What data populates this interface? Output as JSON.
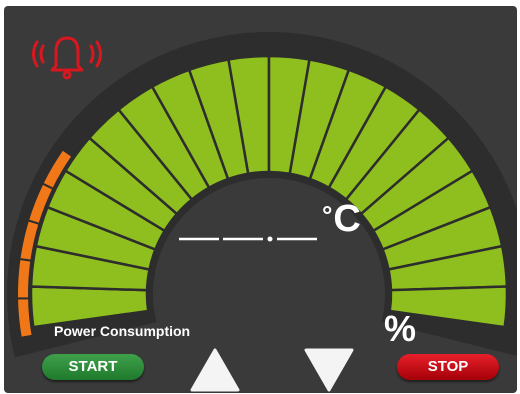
{
  "screen": {
    "temperature_unit_symbol": "°",
    "temperature_unit_letter": "C",
    "temperature_readout": "___.___",
    "percent_symbol": "%",
    "power_label": "Power Consumption"
  },
  "controls": {
    "start_label": "START",
    "stop_label": "STOP"
  },
  "gauges": {
    "temperature_arc": {
      "segments": 20,
      "color": "#8fbf1e",
      "track_color": "#2d2d2d"
    },
    "power_arc": {
      "level_fraction": 0.27,
      "color": "#f07818"
    }
  },
  "icons": {
    "alarm": "alarm-bell-icon",
    "increase": "arrow-up-icon",
    "decrease": "arrow-down-icon"
  },
  "colors": {
    "background": "#3a3a3a",
    "alarm": "#d8171f",
    "start": "#2e8f3c",
    "stop": "#d0121b"
  }
}
